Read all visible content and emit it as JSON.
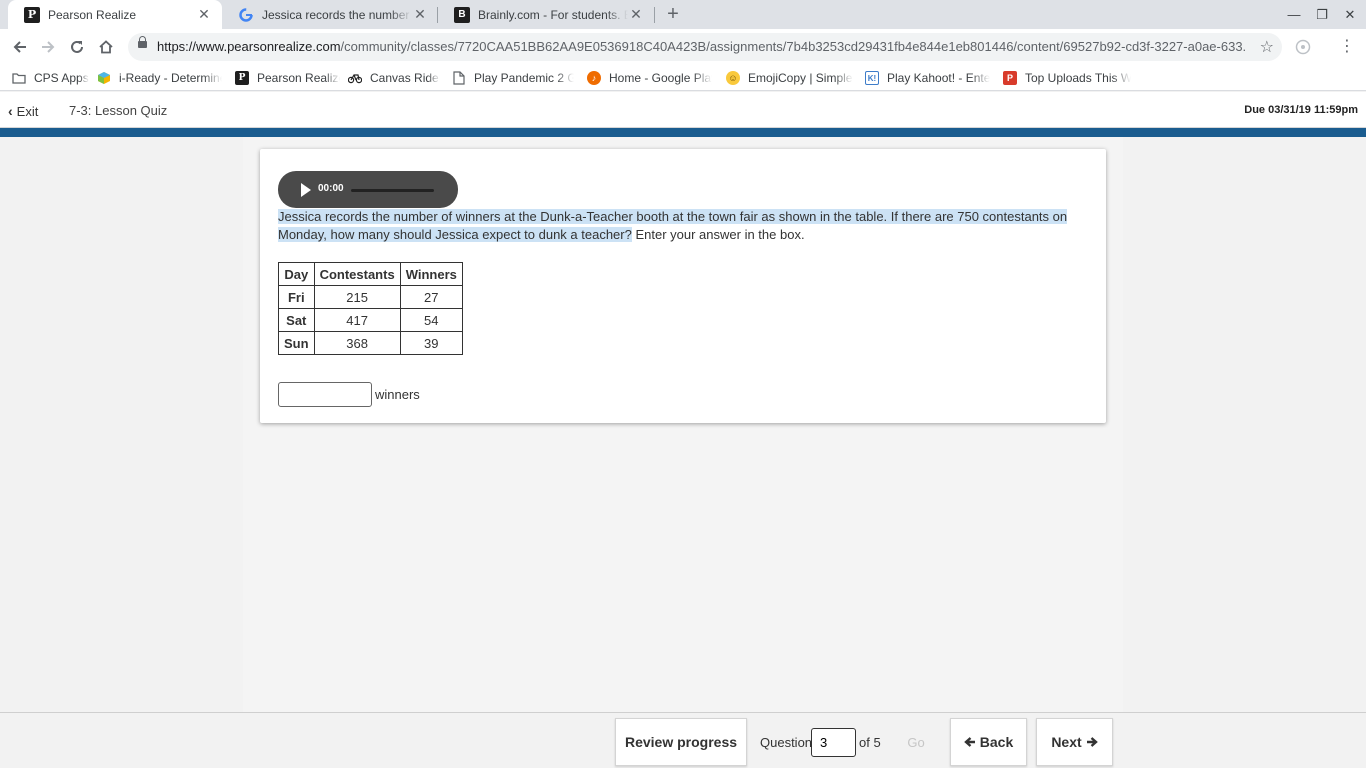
{
  "browser": {
    "tabs": [
      {
        "title": "Pearson Realize",
        "icon": "P",
        "active": true
      },
      {
        "title": "Jessica records the number of winners",
        "icon": "G",
        "active": false
      },
      {
        "title": "Brainly.com - For students. By students",
        "icon": "B",
        "active": false
      }
    ],
    "url_host": "https://www.pearsonrealize.com",
    "url_path": "/community/classes/7720CAA51BB62AA9E0536918C40A423B/assignments/7b4b3253cd29431fb4e844e1eb801446/content/69527b92-cd3f-3227-a0ae-633...",
    "bookmarks": [
      {
        "label": "CPS Apps",
        "icon": "folder-icon"
      },
      {
        "label": "i-Ready - Determine Y",
        "icon": "iready-icon"
      },
      {
        "label": "Pearson Realize",
        "icon": "pearson-icon"
      },
      {
        "label": "Canvas Rider",
        "icon": "bike-icon"
      },
      {
        "label": "Play Pandemic 2 Ga",
        "icon": "page-icon"
      },
      {
        "label": "Home - Google Play",
        "icon": "music-icon"
      },
      {
        "label": "EmojiCopy | Simple e",
        "icon": "emoji-icon"
      },
      {
        "label": "Play Kahoot! - Enter",
        "icon": "kahoot-icon"
      },
      {
        "label": "Top Uploads This W",
        "icon": "p-red-icon"
      }
    ]
  },
  "header": {
    "exit_label": "Exit",
    "quiz_title": "7-3: Lesson Quiz",
    "due": "Due 03/31/19 11:59pm"
  },
  "question": {
    "audio_time": "00:00",
    "text_highlighted": "Jessica records the number of winners at the Dunk-a-Teacher booth at the town fair as shown in the table. If there are 750 contestants on Monday, how many should Jessica expect to dunk a teacher?",
    "text_plain": " Enter your answer in the box.",
    "table": {
      "headers": [
        "Day",
        "Contestants",
        "Winners"
      ],
      "rows": [
        [
          "Fri",
          "215",
          "27"
        ],
        [
          "Sat",
          "417",
          "54"
        ],
        [
          "Sun",
          "368",
          "39"
        ]
      ]
    },
    "answer_value": "",
    "answer_unit": "winners"
  },
  "footer": {
    "review_label": "Review progress",
    "question_label": "Question",
    "question_number": "3",
    "of_label": "of 5",
    "go_label": "Go",
    "back_label": "Back",
    "next_label": "Next"
  },
  "colors": {
    "brand_bar": "#1a5c8f",
    "highlight": "#cce2f5",
    "audio_bg": "#4a4a4a"
  }
}
